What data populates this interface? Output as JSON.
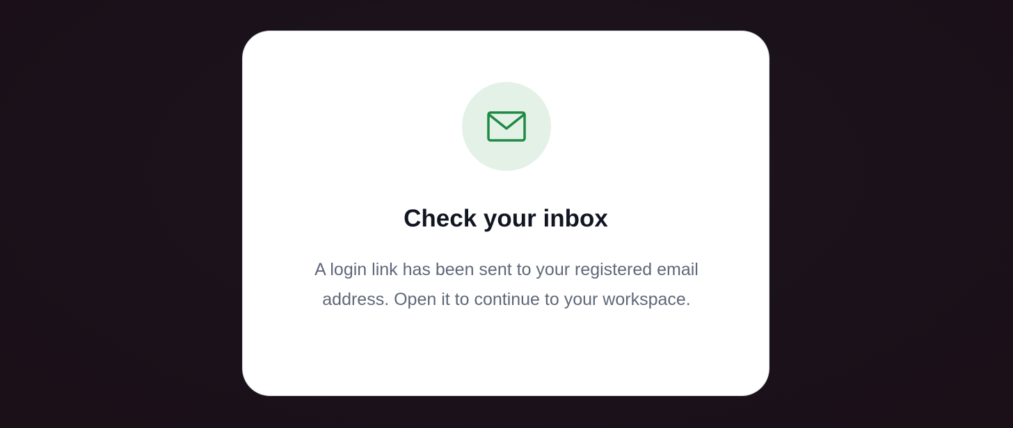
{
  "card": {
    "icon": "envelope-icon",
    "title": "Check your inbox",
    "message": "A login link has been sent to your registered email address. Open it to continue to your workspace."
  },
  "colors": {
    "accent": "#1f8a43",
    "icon_background": "#e4f1e7",
    "title": "#111622",
    "message": "#5f6878",
    "page_background": "#1c121b"
  }
}
